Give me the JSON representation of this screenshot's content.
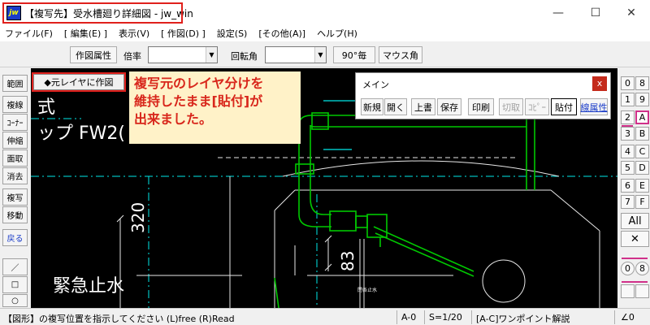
{
  "window": {
    "title": "【複写先】受水槽廻り詳細図 - jw_win",
    "app_icon_text": "jw",
    "controls": {
      "minimize": "—",
      "maximize": "☐",
      "close": "✕"
    }
  },
  "menu": {
    "items": [
      "ファイル(F)",
      "[ 編集(E) ]",
      "表示(V)",
      "[ 作図(D) ]",
      "設定(S)",
      "[その他(A)]",
      "ヘルプ(H)"
    ]
  },
  "toolbar": {
    "draw_attr": "作図属性",
    "scale_label": "倍率",
    "scale_value": "",
    "rotation_label": "回転角",
    "rotation_value": "",
    "rot90": "90°毎",
    "mouse_angle": "マウス角"
  },
  "left_tools": {
    "items": [
      "範囲",
      "複線",
      "ｺｰﾅｰ",
      "伸縮",
      "面取",
      "消去",
      "複写",
      "移動",
      "戻る"
    ],
    "shapes": [
      "／",
      "□",
      "○"
    ]
  },
  "canvas": {
    "layer_button": "◆元レイヤに作図",
    "note_lines": [
      "複写元のレイヤ分けを",
      "維持したまま[貼付]が",
      "出来ました。"
    ],
    "text_shiki": "式",
    "text_pump": "ップ FW2(",
    "dim_320": "320",
    "dim_83": "83",
    "text_emergency": "緊急止水",
    "small_label": "閉各止水",
    "colors": {
      "green": "#00c800",
      "cyan": "#00e8e8",
      "white": "#ffffff",
      "note_bg": "#fff2c8",
      "note_text": "#d8261b",
      "highlight": "#e0201c"
    }
  },
  "palette": {
    "title": "メイン",
    "close": "x",
    "buttons": [
      {
        "label": "新規",
        "state": "normal"
      },
      {
        "label": "開く",
        "state": "normal"
      },
      {
        "label": "上書",
        "state": "normal"
      },
      {
        "label": "保存",
        "state": "normal"
      },
      {
        "label": "印刷",
        "state": "normal"
      },
      {
        "label": "切取",
        "state": "disabled"
      },
      {
        "label": "ｺﾋﾟｰ",
        "state": "disabled"
      },
      {
        "label": "貼付",
        "state": "active"
      },
      {
        "label": "線属性",
        "state": "blue"
      }
    ]
  },
  "right_layers": {
    "row_labels": [
      "0",
      "8",
      "1",
      "9",
      "2",
      "A",
      "3",
      "B",
      "4",
      "C",
      "5",
      "D",
      "6",
      "E",
      "7",
      "F"
    ],
    "all_label": "All",
    "cross_label": "✕",
    "group_labels": [
      "0",
      "8"
    ],
    "selected": "A"
  },
  "status": {
    "message": "【図形】の複写位置を指示してください (L)free (R)Read",
    "layer": "A-0",
    "scale": "S=1/20",
    "help": "[A-C]ワンポイント解説",
    "angle": "∠0"
  }
}
